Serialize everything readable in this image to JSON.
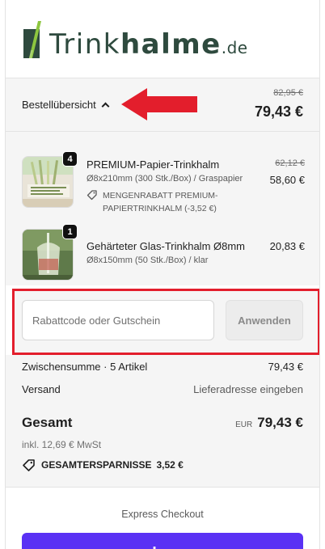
{
  "brand": {
    "name_light": "Trink",
    "name_bold": "halme",
    "tld": ".de",
    "color": "#2e4a3e",
    "accent": "#8dc63f"
  },
  "summary": {
    "toggle_label": "Bestellübersicht",
    "old_total": "82,95 €",
    "total": "79,43 €"
  },
  "items": [
    {
      "title": "PREMIUM-Papier-Trinkhalm",
      "subtitle": "Ø8x210mm (300 Stk./Box) / Graspapier",
      "quantity": "4",
      "discount": "MENGENRABATT PREMIUM-PAPIERTRINKHALM (-3,52 €)",
      "old_price": "62,12 €",
      "price": "58,60 €"
    },
    {
      "title": "Gehärteter Glas-Trinkhalm Ø8mm",
      "subtitle": "Ø8x150mm (50 Stk./Box) / klar",
      "quantity": "1",
      "price": "20,83 €"
    }
  ],
  "discount_form": {
    "placeholder": "Rabattcode oder Gutschein",
    "apply_label": "Anwenden"
  },
  "totals": {
    "subtotal_label": "Zwischensumme · 5 Artikel",
    "subtotal_value": "79,43 €",
    "shipping_label": "Versand",
    "shipping_value": "Lieferadresse eingeben",
    "total_label": "Gesamt",
    "currency": "EUR",
    "total_value": "79,43 €",
    "tax_note": "inkl. 12,69 € MwSt",
    "savings_label": "GESAMTERSPARNISSE",
    "savings_value": "3,52 €"
  },
  "express": {
    "label": "Express Checkout",
    "shop_label": "shop",
    "shop_color": "#5a31f4"
  },
  "annotations": {
    "highlight_color": "#e31e2c"
  }
}
